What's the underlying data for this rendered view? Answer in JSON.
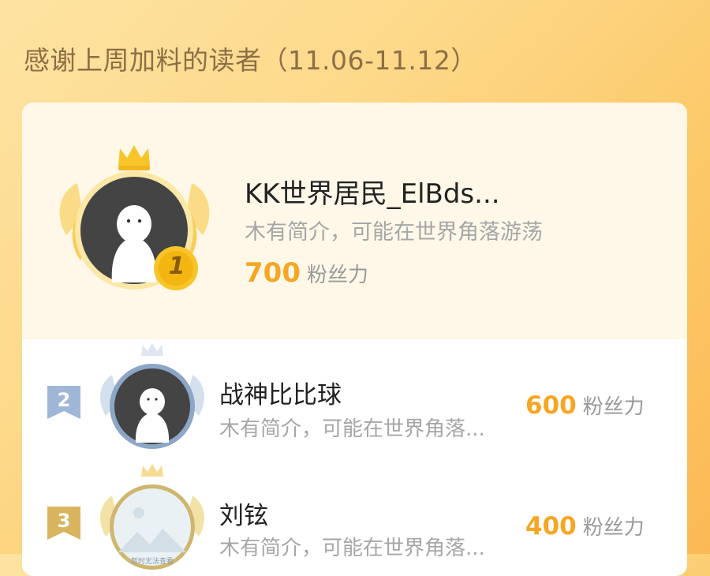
{
  "header": {
    "title": "感谢上周加料的读者（11.06-11.12）"
  },
  "leaderboard": {
    "entries": [
      {
        "rank": "1",
        "name": "KK世界居民_ElBds...",
        "bio": "木有简介，可能在世界角落游荡",
        "fans": "700",
        "unit": "粉丝力"
      },
      {
        "rank": "2",
        "name": "战神比比球",
        "bio": "木有简介，可能在世界角落...",
        "fans": "600",
        "unit": "粉丝力"
      },
      {
        "rank": "3",
        "name": "刘铉",
        "bio": "木有简介，可能在世界角落...",
        "fans": "400",
        "unit": "粉丝力",
        "avatar_placeholder": "暂时无法查看"
      }
    ]
  },
  "colors": {
    "gold": "#f7c42a",
    "silver": "#9fb6d6",
    "bronze": "#d9b45e",
    "fans_accent": "#f5a623"
  }
}
